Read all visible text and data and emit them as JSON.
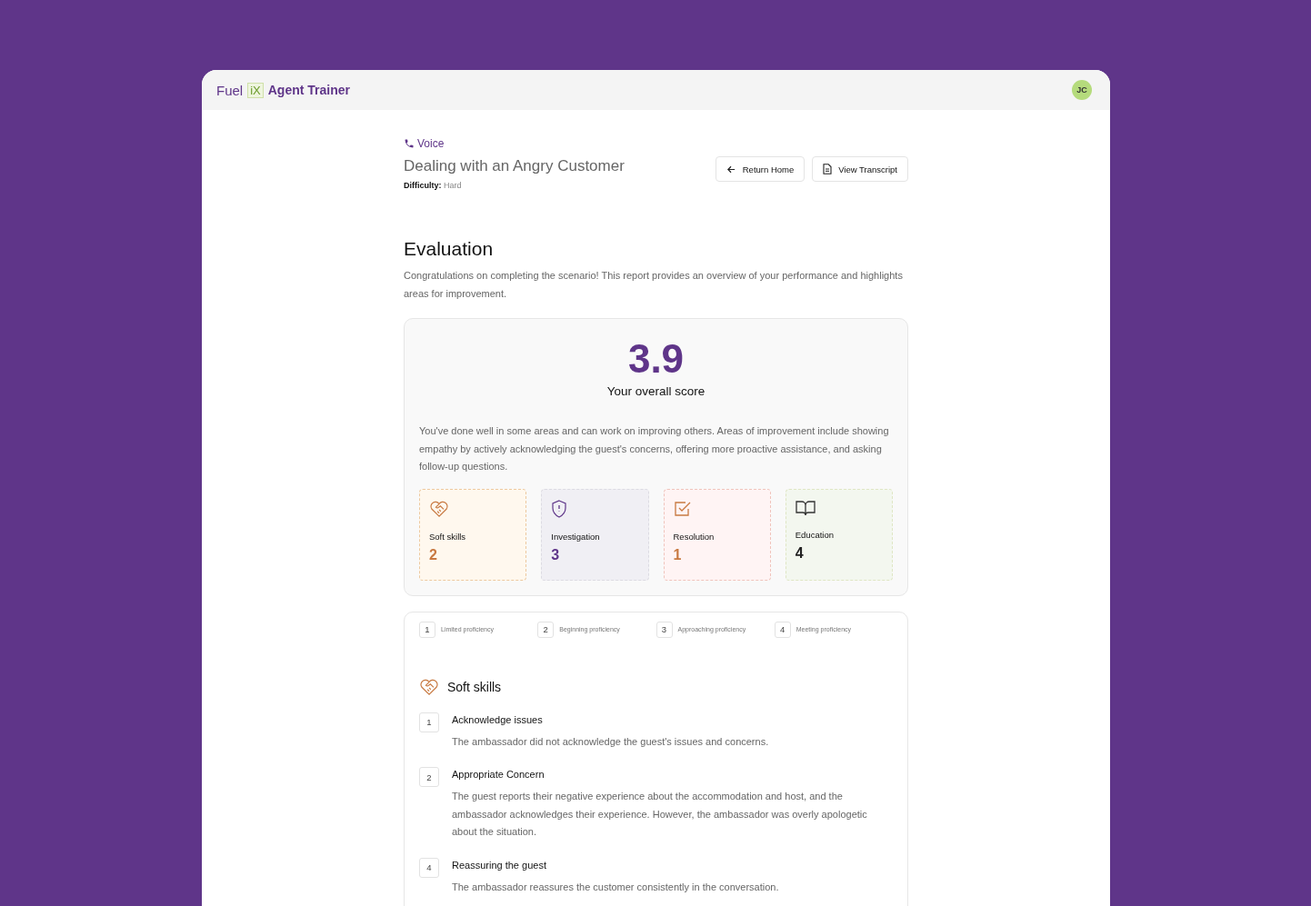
{
  "header": {
    "brand": "Fuel",
    "brand_mark": "iX",
    "product": "Agent Trainer",
    "avatar": "JC"
  },
  "scenario": {
    "channel": "Voice",
    "title": "Dealing with an Angry Customer",
    "difficulty_label": "Difficulty:",
    "difficulty": "Hard"
  },
  "buttons": [
    {
      "kind": "back",
      "label": "Return Home"
    },
    {
      "kind": "transcript",
      "label": "View Transcript"
    }
  ],
  "evaluation": {
    "heading": "Evaluation",
    "intro": "Congratulations on completing the scenario! This report provides an overview of your performance and highlights areas for improvement."
  },
  "score": {
    "value": "3.9",
    "label": "Your overall score",
    "summary": "You've done well in some areas and can work on improving others. Areas of improvement include showing empathy by actively acknowledging the guest's concerns, offering more proactive assistance, and asking follow-up questions."
  },
  "categories": [
    {
      "kind": "soft",
      "name": "Soft skills",
      "score": "2",
      "color": "#c87941"
    },
    {
      "kind": "investigation",
      "name": "Investigation",
      "score": "3",
      "color": "#5f3589"
    },
    {
      "kind": "resolution",
      "name": "Resolution",
      "score": "1",
      "color": "#c87941"
    },
    {
      "kind": "education",
      "name": "Education",
      "score": "4",
      "color": "#222222"
    }
  ],
  "legend": [
    {
      "number": "1",
      "label": "Limited proficiency"
    },
    {
      "number": "2",
      "label": "Beginning proficiency"
    },
    {
      "number": "3",
      "label": "Approaching proficiency"
    },
    {
      "number": "4",
      "label": "Meeting proficiency"
    }
  ],
  "section": {
    "title": "Soft skills",
    "items": [
      {
        "score": "1",
        "title": "Acknowledge issues",
        "text": "The ambassador did not acknowledge the guest's issues and concerns."
      },
      {
        "score": "2",
        "title": "Appropriate Concern",
        "text": "The guest reports their negative experience about the accommodation and host, and the ambassador acknowledges their experience. However, the ambassador was overly apologetic about the situation."
      },
      {
        "score": "4",
        "title": "Reassuring the guest",
        "text": "The ambassador reassures the customer consistently in the conversation."
      }
    ]
  }
}
